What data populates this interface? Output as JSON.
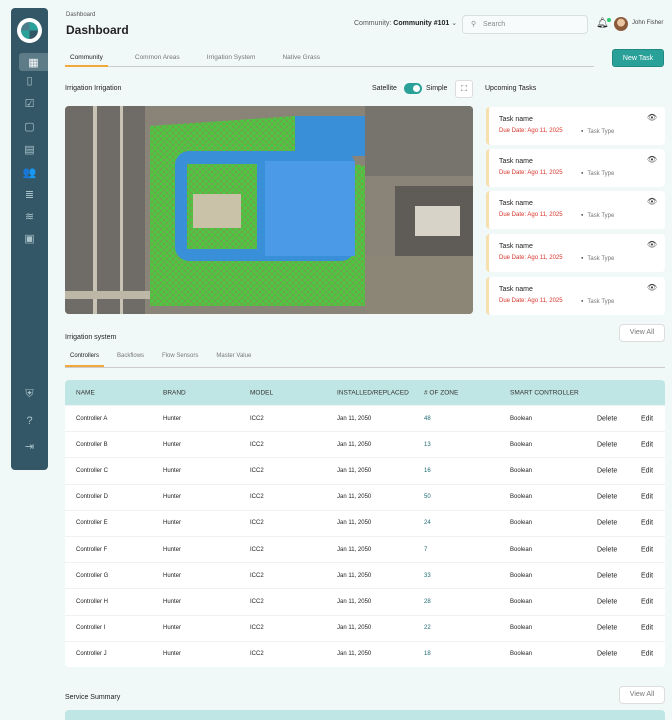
{
  "sidebar": {
    "items": [
      "dashboard",
      "map",
      "checklist",
      "clipboard",
      "document",
      "users",
      "list",
      "water",
      "contact"
    ],
    "bottom": [
      "shield",
      "help",
      "logout"
    ]
  },
  "header": {
    "breadcrumb": "Dashboard",
    "title": "Dashboard",
    "community_label": "Community:",
    "community_value": "Community #101",
    "search_placeholder": "Search",
    "user_name": "John Fisher"
  },
  "tabs": [
    "Community",
    "Common Areas",
    "Irrigation System",
    "Native Grass"
  ],
  "new_task": "New Task",
  "map_section": {
    "title": "Irrigation Irrigation",
    "satellite": "Satellite",
    "simple": "Simple",
    "toggle_on": true
  },
  "upcoming": {
    "title": "Upcoming Tasks",
    "tasks": [
      {
        "name": "Task name",
        "due": "Due Date: Ago 11, 2025",
        "type": "Task Type"
      },
      {
        "name": "Task name",
        "due": "Due Date: Ago 11, 2025",
        "type": "Task Type"
      },
      {
        "name": "Task name",
        "due": "Due Date: Ago 11, 2025",
        "type": "Task Type"
      },
      {
        "name": "Task name",
        "due": "Due Date: Ago 11, 2025",
        "type": "Task Type"
      },
      {
        "name": "Task name",
        "due": "Due Date: Ago 11, 2025",
        "type": "Task Type"
      }
    ]
  },
  "irrigation": {
    "title": "Irrigation system",
    "view_all": "View All",
    "tabs": [
      "Controllers",
      "Backflows",
      "Flow Sensors",
      "Master Value"
    ],
    "columns": [
      "NAME",
      "BRAND",
      "MODEL",
      "INSTALLED/REPLACED",
      "# OF ZONE",
      "SMART CONTROLLER"
    ],
    "delete": "Delete",
    "edit": "Edit",
    "rows": [
      [
        "Controller A",
        "Hunter",
        "ICC2",
        "Jan 11, 2050",
        "48",
        "Boolean"
      ],
      [
        "Controller B",
        "Hunter",
        "ICC2",
        "Jan 11, 2050",
        "13",
        "Boolean"
      ],
      [
        "Controller C",
        "Hunter",
        "ICC2",
        "Jan 11, 2050",
        "16",
        "Boolean"
      ],
      [
        "Controller D",
        "Hunter",
        "ICC2",
        "Jan 11, 2050",
        "50",
        "Boolean"
      ],
      [
        "Controller E",
        "Hunter",
        "ICC2",
        "Jan 11, 2050",
        "24",
        "Boolean"
      ],
      [
        "Controller F",
        "Hunter",
        "ICC2",
        "Jan 11, 2050",
        "7",
        "Boolean"
      ],
      [
        "Controller G",
        "Hunter",
        "ICC2",
        "Jan 11, 2050",
        "33",
        "Boolean"
      ],
      [
        "Controller H",
        "Hunter",
        "ICC2",
        "Jan 11, 2050",
        "28",
        "Boolean"
      ],
      [
        "Controller I",
        "Hunter",
        "ICC2",
        "Jan 11, 2050",
        "22",
        "Boolean"
      ],
      [
        "Controller J",
        "Hunter",
        "ICC2",
        "Jan 11, 2050",
        "18",
        "Boolean"
      ]
    ]
  },
  "service": {
    "title": "Service Summary",
    "view_all": "View All"
  }
}
